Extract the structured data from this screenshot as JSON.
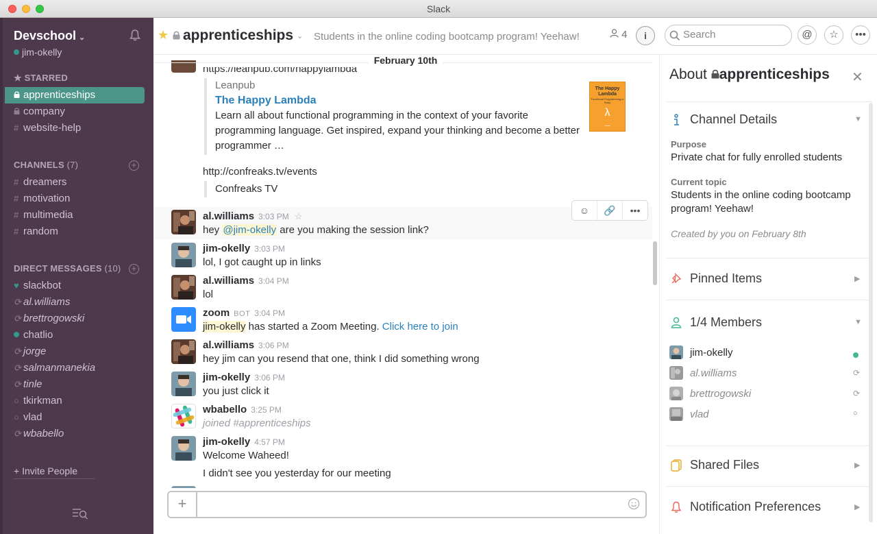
{
  "window": {
    "title": "Slack"
  },
  "sidebar": {
    "team_name": "Devschool",
    "user": "jim-okelly",
    "starred_header": "STARRED",
    "starred": [
      {
        "label": "apprenticeships",
        "prefix": "lock",
        "active": true
      },
      {
        "label": "company",
        "prefix": "lock"
      },
      {
        "label": "website-help",
        "prefix": "#"
      }
    ],
    "channels_header": "CHANNELS",
    "channels_count": "(7)",
    "channels": [
      {
        "label": "dreamers"
      },
      {
        "label": "motivation"
      },
      {
        "label": "multimedia"
      },
      {
        "label": "random"
      }
    ],
    "dm_header": "DIRECT MESSAGES",
    "dm_count": "(10)",
    "dms": [
      {
        "label": "slackbot",
        "status": "heart"
      },
      {
        "label": "al.williams",
        "status": "away"
      },
      {
        "label": "brettrogowski",
        "status": "away"
      },
      {
        "label": "chatlio",
        "status": "online"
      },
      {
        "label": "jorge",
        "status": "away"
      },
      {
        "label": "salmanmanekia",
        "status": "away"
      },
      {
        "label": "tinle",
        "status": "away"
      },
      {
        "label": "tkirkman",
        "status": "offline"
      },
      {
        "label": "vlad",
        "status": "offline"
      },
      {
        "label": "wbabello",
        "status": "away"
      }
    ],
    "invite_label": "+ Invite People"
  },
  "header": {
    "channel": "apprenticeships",
    "topic": "Students in the online coding bootcamp program! Yeehaw!",
    "member_count": "4",
    "search_placeholder": "Search"
  },
  "messages": {
    "date": "February 10th",
    "top_link": "https://leanpub.com/happylambda",
    "attachment1": {
      "service": "Leanpub",
      "title": "The Happy Lambda",
      "desc1": "Learn all about functional programming in the context of your favorite",
      "desc2": "programming language. Get inspired, expand your thinking and become a better",
      "desc3": "programmer …",
      "thumb_title": "The Happy Lambda",
      "thumb_sub": "Functional Programming in Ruby"
    },
    "link2": "http://confreaks.tv/events",
    "attachment2": {
      "text": "Confreaks TV"
    },
    "items": [
      {
        "user": "al.williams",
        "time": "3:03 PM",
        "pre": "hey ",
        "mention": "@jim-okelly",
        "post": " are you making the session link?"
      },
      {
        "user": "jim-okelly",
        "time": "3:03 PM",
        "text": "lol, I got caught up in links"
      },
      {
        "user": "al.williams",
        "time": "3:04 PM",
        "text": "lol"
      },
      {
        "user": "zoom",
        "badge": "BOT",
        "time": "3:04 PM",
        "mention": "jim-okelly",
        "mid": " has started a Zoom Meeting. ",
        "link": "Click here to join"
      },
      {
        "user": "al.williams",
        "time": "3:06 PM",
        "text": "hey jim can you resend that one, think I did something wrong"
      },
      {
        "user": "jim-okelly",
        "time": "3:06 PM",
        "text": "you just click it"
      },
      {
        "user": "wbabello",
        "time": "3:25 PM",
        "text": "joined #apprenticeships"
      },
      {
        "user": "jim-okelly",
        "time": "4:57 PM",
        "text": "Welcome Waheed!",
        "text2": "I didn't see you yesterday for our meeting"
      }
    ]
  },
  "composer": {
    "placeholder": ""
  },
  "about": {
    "title_prefix": "About",
    "channel": "apprenticeships",
    "details_label": "Channel Details",
    "purpose_label": "Purpose",
    "purpose": "Private chat for fully enrolled students",
    "topic_label": "Current topic",
    "topic": "Students in the online coding bootcamp program! Yeehaw!",
    "created": "Created by you on February 8th",
    "pinned_label": "Pinned Items",
    "members_label": "1/4 Members",
    "members": [
      {
        "name": "jim-okelly",
        "status": "online"
      },
      {
        "name": "al.williams",
        "status": "away"
      },
      {
        "name": "brettrogowski",
        "status": "away"
      },
      {
        "name": "vlad",
        "status": "offline"
      }
    ],
    "files_label": "Shared Files",
    "notif_label": "Notification Preferences"
  },
  "colors": {
    "sidebar": "#4d394b",
    "active": "#4c9689",
    "link": "#2a80b9",
    "mention_bg": "#fdf6d3"
  }
}
